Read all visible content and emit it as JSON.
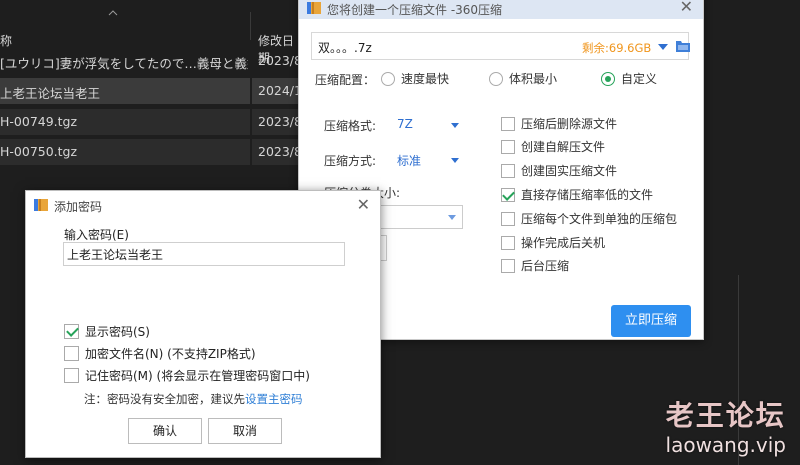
{
  "explorer": {
    "col_name": "称",
    "col_date": "修改日期",
    "rows": [
      {
        "name": "[ユウリコ]妻が浮気をしてたので…義母と義妹…",
        "date": "2023/8"
      },
      {
        "name": "上老王论坛当老王",
        "date": "2024/1"
      },
      {
        "name": "H-00749.tgz",
        "date": "2023/8"
      },
      {
        "name": "H-00750.tgz",
        "date": "2023/8"
      }
    ],
    "watermark_title": "老王论坛",
    "watermark_url": "laowang.vip"
  },
  "compress": {
    "title": "您将创建一个压缩文件 -360压缩",
    "path_value": "双。。。.7z",
    "free_space": "剩余:69.6GB",
    "config_label": "压缩配置：",
    "config_options": [
      {
        "label": "速度最快",
        "selected": false
      },
      {
        "label": "体积最小",
        "selected": false
      },
      {
        "label": "自定义",
        "selected": true
      }
    ],
    "format_label": "压缩格式:",
    "format_value": "7Z",
    "method_label": "压缩方式:",
    "method_value": "标准",
    "split_label": "压缩分卷大小:",
    "options": [
      {
        "label": "压缩后删除源文件",
        "checked": false
      },
      {
        "label": "创建自解压文件",
        "checked": false
      },
      {
        "label": "创建固实压缩文件",
        "checked": false
      },
      {
        "label": "直接存储压缩率低的文件",
        "checked": true
      },
      {
        "label": "压缩每个文件到单独的压缩包",
        "checked": false
      },
      {
        "label": "操作完成后关机",
        "checked": false
      },
      {
        "label": "后台压缩",
        "checked": false
      }
    ],
    "compress_button": "立即压缩"
  },
  "password_dialog": {
    "title": "添加密码",
    "input_label": "输入密码(E)",
    "input_value": "上老王论坛当老王",
    "show_password": "显示密码(S)",
    "encrypt_names": "加密文件名(N) (不支持ZIP格式)",
    "remember_password": "记住密码(M) (将会显示在管理密码窗口中)",
    "note_prefix": "注：密码没有安全加密，建议先",
    "note_link": "设置主密码",
    "ok_button": "确认",
    "cancel_button": "取消"
  },
  "colors": {
    "accent_blue": "#2e8ff0",
    "check_green": "#27a35a",
    "free_space_orange": "#f0951c"
  }
}
